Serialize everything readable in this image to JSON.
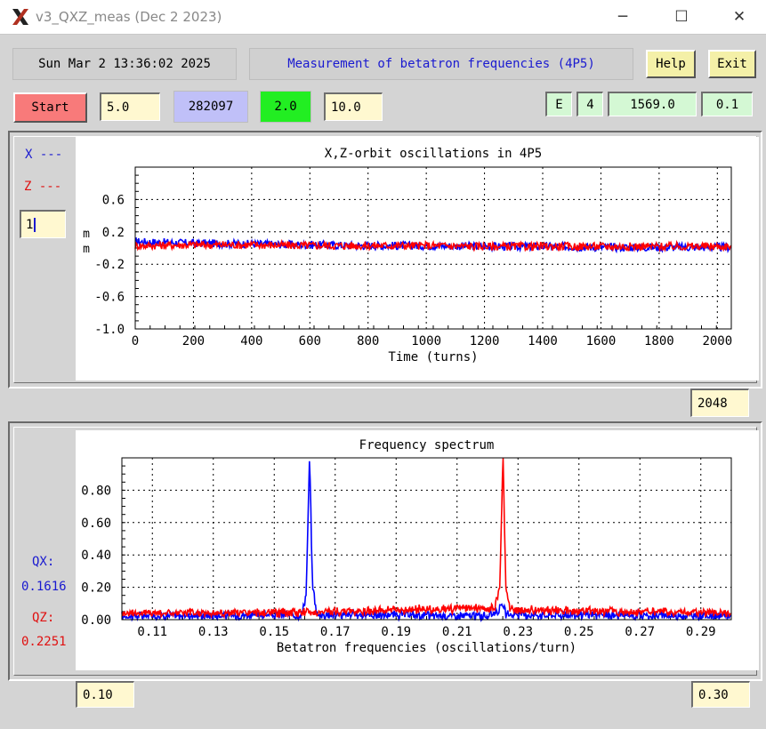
{
  "window": {
    "title": "v3_QXZ_meas (Dec  2 2023)",
    "minimize": "─",
    "maximize": "☐",
    "close": "✕"
  },
  "header": {
    "datetime": "Sun Mar  2 13:36:02 2025",
    "subtitle": "Measurement of betatron frequencies (4P5)",
    "help_label": "Help",
    "exit_label": "Exit"
  },
  "controls": {
    "start_label": "Start",
    "field1": "5.0",
    "counter": "282097",
    "field3": "2.0",
    "field4": "10.0",
    "mode": "E",
    "num": "4",
    "energy": "1569.0",
    "step": "0.1"
  },
  "orbit_panel": {
    "legend_x": "X ---",
    "legend_z": "Z ---",
    "input_value": "1",
    "turns_field": "2048",
    "colors": {
      "x": "#0000ff",
      "z": "#ff0000"
    }
  },
  "spectrum_panel": {
    "qx_label": "QX:",
    "qx_value": "0.1616",
    "qz_label": "QZ:",
    "qz_value": "0.2251",
    "min_field": "0.10",
    "max_field": "0.30"
  },
  "chart_data": [
    {
      "type": "line",
      "title": "X,Z-orbit oscillations in 4P5",
      "xlabel": "Time (turns)",
      "ylabel": "m\nm",
      "xlim": [
        0,
        2048
      ],
      "ylim": [
        -1.0,
        1.0
      ],
      "xticks": [
        0,
        200,
        400,
        600,
        800,
        1000,
        1200,
        1400,
        1600,
        1800,
        2000
      ],
      "yticks": [
        "0.6",
        "0.2",
        "-0.2",
        "-0.6",
        "-1.0"
      ],
      "grid": true,
      "series": [
        {
          "name": "X",
          "color": "#0000ff",
          "x": [
            0,
            200,
            400,
            600,
            800,
            1000,
            1200,
            1400,
            1600,
            1800,
            2048
          ],
          "values": [
            0.08,
            0.06,
            0.05,
            0.04,
            0.03,
            0.03,
            0.02,
            0.02,
            0.01,
            0.01,
            0.01
          ]
        },
        {
          "name": "Z",
          "color": "#ff0000",
          "x": [
            0,
            200,
            400,
            600,
            800,
            1000,
            1200,
            1400,
            1600,
            1800,
            2048
          ],
          "values": [
            0.03,
            0.04,
            0.04,
            0.03,
            0.03,
            0.03,
            0.02,
            0.02,
            0.02,
            0.02,
            0.02
          ]
        }
      ]
    },
    {
      "type": "line",
      "title": "Frequency spectrum",
      "xlabel": "Betatron frequencies (oscillations/turn)",
      "xlim": [
        0.1,
        0.3
      ],
      "ylim": [
        0.0,
        1.0
      ],
      "xticks": [
        "0.11",
        "0.13",
        "0.15",
        "0.17",
        "0.19",
        "0.21",
        "0.23",
        "0.25",
        "0.27",
        "0.29"
      ],
      "yticks": [
        "0.80",
        "0.60",
        "0.40",
        "0.20",
        "0.00"
      ],
      "grid": true,
      "series": [
        {
          "name": "QX",
          "color": "#0000ff",
          "x": [
            0.1,
            0.159,
            0.1605,
            0.1616,
            0.1625,
            0.164,
            0.22,
            0.2245,
            0.2251,
            0.226,
            0.3
          ],
          "values": [
            0.01,
            0.02,
            0.15,
            1.0,
            0.22,
            0.02,
            0.01,
            0.06,
            0.08,
            0.02,
            0.01
          ]
        },
        {
          "name": "QZ",
          "color": "#ff0000",
          "x": [
            0.1,
            0.15,
            0.2225,
            0.224,
            0.2251,
            0.226,
            0.2275,
            0.3
          ],
          "values": [
            0.03,
            0.03,
            0.06,
            0.2,
            1.0,
            0.18,
            0.05,
            0.03
          ]
        }
      ]
    }
  ]
}
